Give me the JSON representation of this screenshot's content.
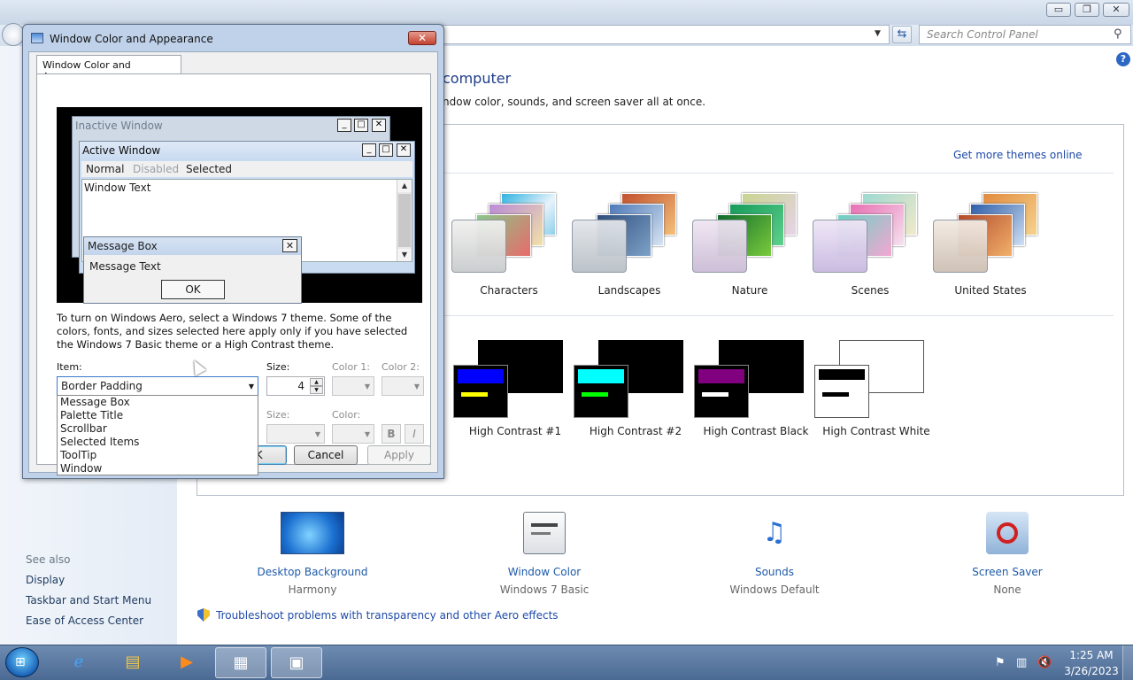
{
  "control_panel": {
    "caption_buttons": {
      "minimize": "▭",
      "maximize": "❐",
      "close": "✕"
    },
    "search_placeholder": "Search Control Panel",
    "heading": "computer",
    "description": "ndow color, sounds, and screen saver all at once.",
    "get_more_themes": "Get more themes online",
    "help_glyph": "?",
    "themes": [
      {
        "name": "Characters"
      },
      {
        "name": "Landscapes"
      },
      {
        "name": "Nature"
      },
      {
        "name": "Scenes"
      },
      {
        "name": "United States"
      }
    ],
    "high_contrast": [
      {
        "name": "High Contrast #1",
        "bar": "#0000ff",
        "line": "#ffff00",
        "bg": "#000000"
      },
      {
        "name": "High Contrast #2",
        "bar": "#00ffff",
        "line": "#00ff00",
        "bg": "#000000"
      },
      {
        "name": "High Contrast Black",
        "bar": "#800080",
        "line": "#ffffff",
        "bg": "#000000"
      },
      {
        "name": "High Contrast White",
        "bar": "#000000",
        "line": "#000000",
        "bg": "#ffffff"
      }
    ],
    "bottom_items": [
      {
        "label": "Desktop Background",
        "value": "Harmony"
      },
      {
        "label": "Window Color",
        "value": "Windows 7 Basic"
      },
      {
        "label": "Sounds",
        "value": "Windows Default"
      },
      {
        "label": "Screen Saver",
        "value": "None"
      }
    ],
    "troubleshoot": "Troubleshoot problems with transparency and other Aero effects",
    "see_also": {
      "title": "See also",
      "items": [
        "Display",
        "Taskbar and Start Menu",
        "Ease of Access Center"
      ]
    }
  },
  "dialog": {
    "title": "Window Color and Appearance",
    "close_glyph": "✕",
    "tab": "Window Color and Appearance",
    "preview": {
      "inactive_title": "Inactive Window",
      "active_title": "Active Window",
      "menu": {
        "normal": "Normal",
        "disabled": "Disabled",
        "selected": "Selected"
      },
      "window_text": "Window Text",
      "message_box_title": "Message Box",
      "message_text": "Message Text",
      "ok": "OK",
      "btn_min": "_",
      "btn_max": "□",
      "btn_close": "✕"
    },
    "aero_note": "To turn on Windows Aero, select a Windows 7 theme.  Some of the colors, fonts, and sizes selected here apply only if you have selected the Windows 7 Basic theme or a High Contrast theme.",
    "item_label": "Item:",
    "item_selected": "Border Padding",
    "item_options": [
      "Message Box",
      "Palette Title",
      "Scrollbar",
      "Selected Items",
      "ToolTip",
      "Window"
    ],
    "size_label": "Size:",
    "size_value": "4",
    "color1_label": "Color 1:",
    "color2_label": "Color 2:",
    "size2_label": "Size:",
    "color_label": "Color:",
    "bold_glyph": "B",
    "italic_glyph": "I",
    "buttons": {
      "ok": "OK",
      "cancel": "Cancel",
      "apply": "Apply"
    }
  },
  "taskbar": {
    "clock_time": "1:25 AM",
    "clock_date": "3/26/2023"
  }
}
